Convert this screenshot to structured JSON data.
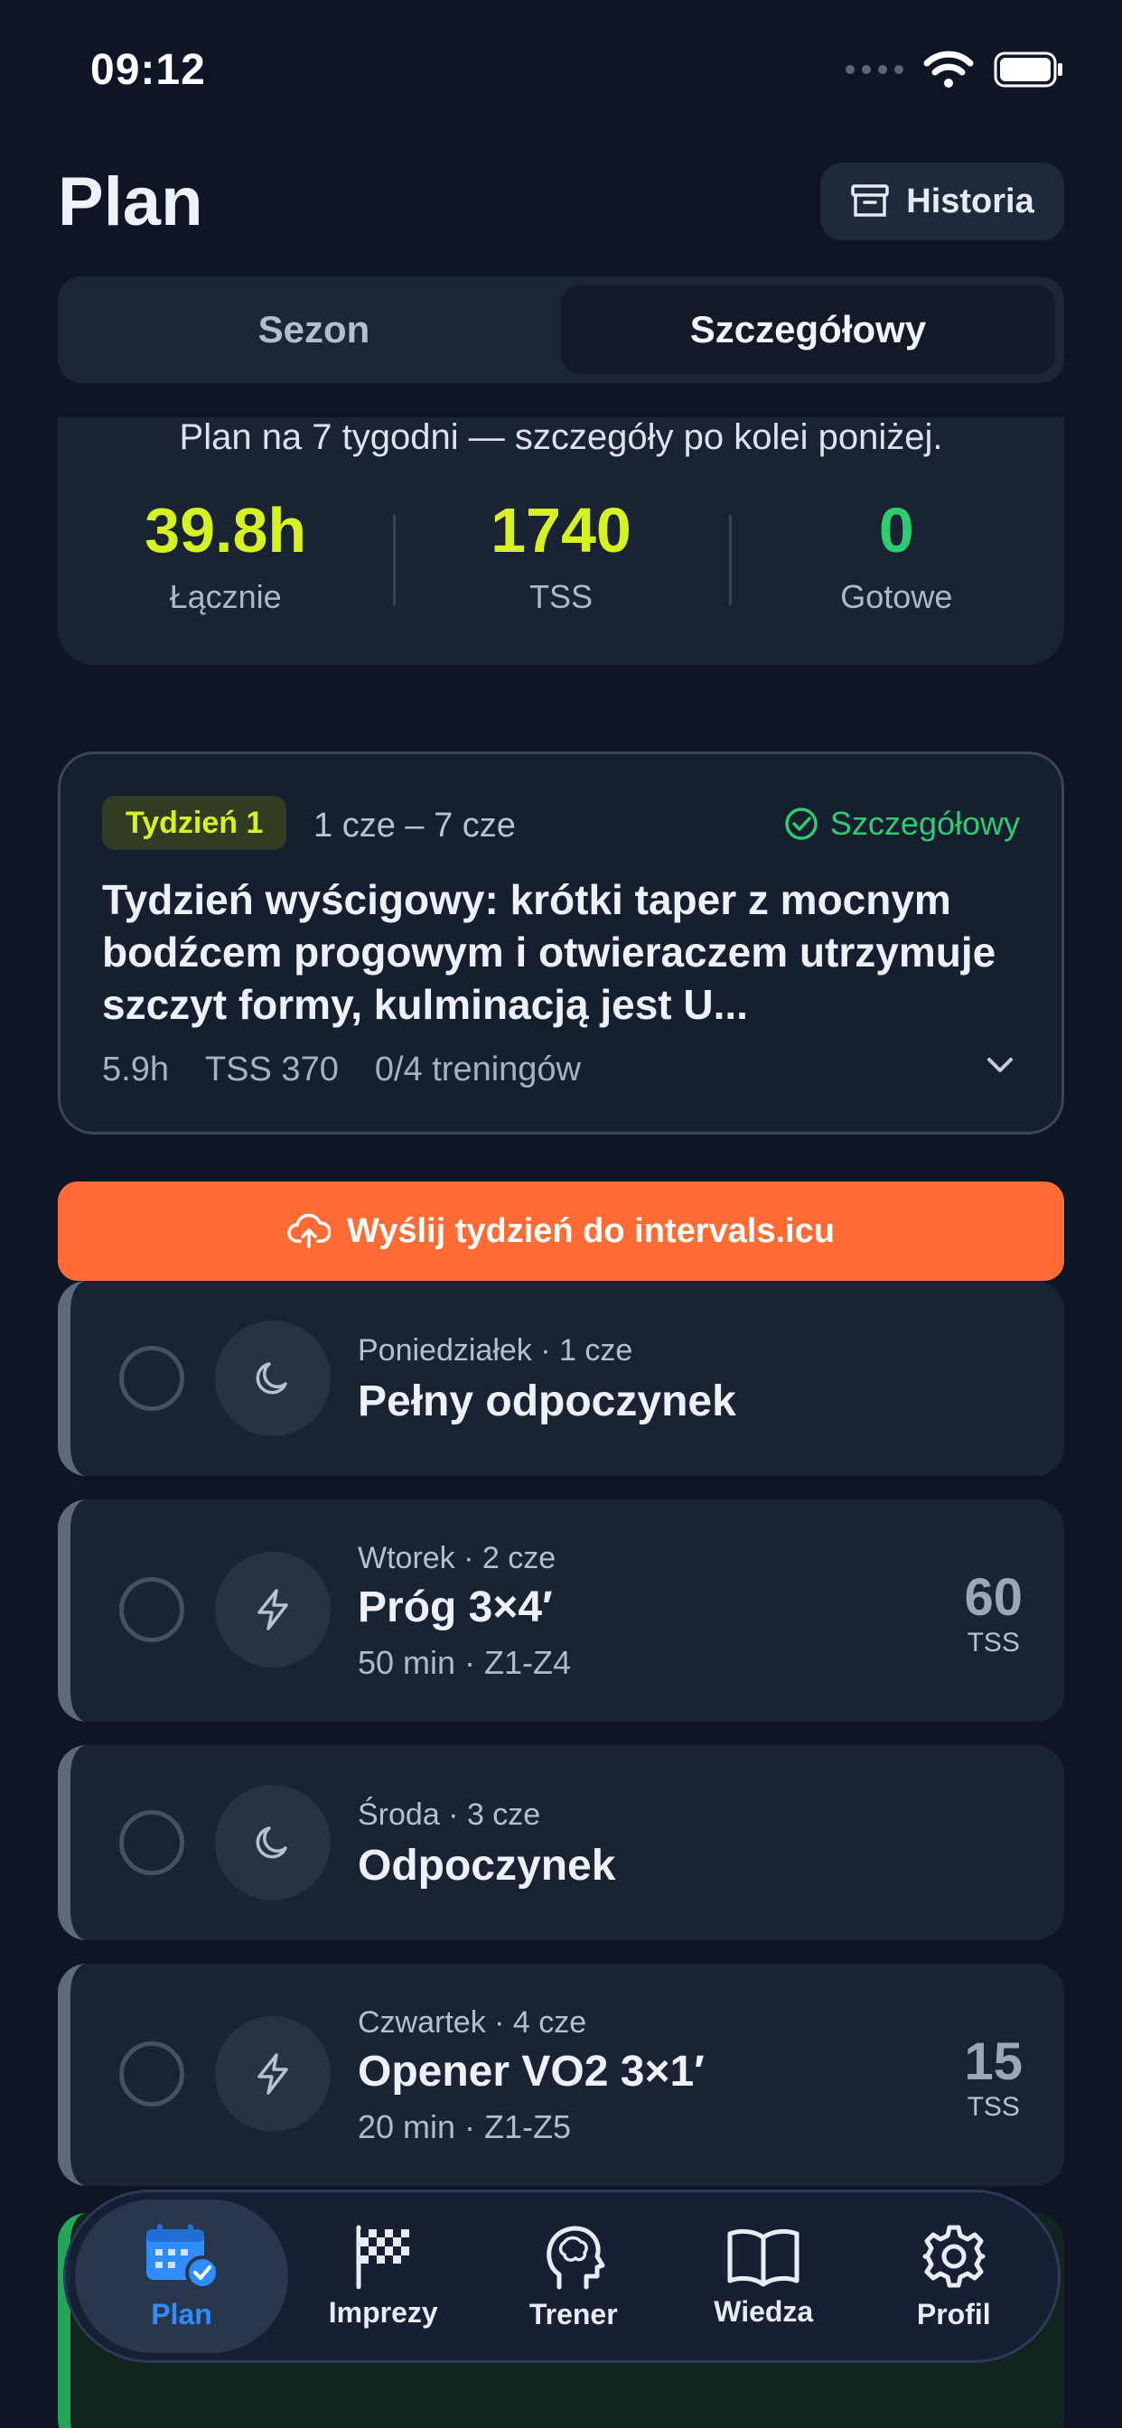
{
  "status_bar": {
    "time": "09:12"
  },
  "header": {
    "title": "Plan",
    "history_label": "Historia"
  },
  "segments": [
    {
      "label": "Sezon",
      "active": false
    },
    {
      "label": "Szczegółowy",
      "active": true
    }
  ],
  "summary": {
    "text": "Plan na 7 tygodni — szczegóły po kolei poniżej.",
    "stats": [
      {
        "value": "39.8h",
        "label": "Łącznie",
        "color": "#d7f223"
      },
      {
        "value": "1740",
        "label": "TSS",
        "color": "#d7f223"
      },
      {
        "value": "0",
        "label": "Gotowe",
        "color": "#2ecc71"
      }
    ]
  },
  "week": {
    "badge": "Tydzień 1",
    "dates": "1 cze – 7 cze",
    "status": "Szczegółowy",
    "description": "Tydzień wyścigowy: krótki taper z mocnym bodźcem progowym i otwieraczem utrzymuje szczyt formy, kulminacją jest U...",
    "hours": "5.9h",
    "tss": "TSS 370",
    "workouts": "0/4 treningów"
  },
  "upload_label": "Wyślij tydzień do intervals.icu",
  "days": [
    {
      "sub": "Poniedziałek · 1 cze",
      "title": "Pełny odpoczynek",
      "meta": "",
      "tss": "",
      "tss_label": "",
      "icon": "moon-icon"
    },
    {
      "sub": "Wtorek · 2 cze",
      "title": "Próg 3×4′",
      "meta": "50 min · Z1-Z4",
      "tss": "60",
      "tss_label": "TSS",
      "icon": "lightning-icon"
    },
    {
      "sub": "Środa · 3 cze",
      "title": "Odpoczynek",
      "meta": "",
      "tss": "",
      "tss_label": "",
      "icon": "moon-icon"
    },
    {
      "sub": "Czwartek · 4 cze",
      "title": "Opener VO2 3×1′",
      "meta": "20 min · Z1-Z5",
      "tss": "15",
      "tss_label": "TSS",
      "icon": "lightning-icon"
    }
  ],
  "tabs": [
    {
      "label": "Plan",
      "icon": "calendar-check-icon",
      "active": true
    },
    {
      "label": "Imprezy",
      "icon": "checkered-flag-icon",
      "active": false
    },
    {
      "label": "Trener",
      "icon": "brain-head-icon",
      "active": false
    },
    {
      "label": "Wiedza",
      "icon": "book-icon",
      "active": false
    },
    {
      "label": "Profil",
      "icon": "gear-icon",
      "active": false
    }
  ],
  "colors": {
    "accent": "#ff6b35",
    "lime": "#d7f223",
    "green": "#2ecc71",
    "tab_active": "#2f8dff"
  }
}
